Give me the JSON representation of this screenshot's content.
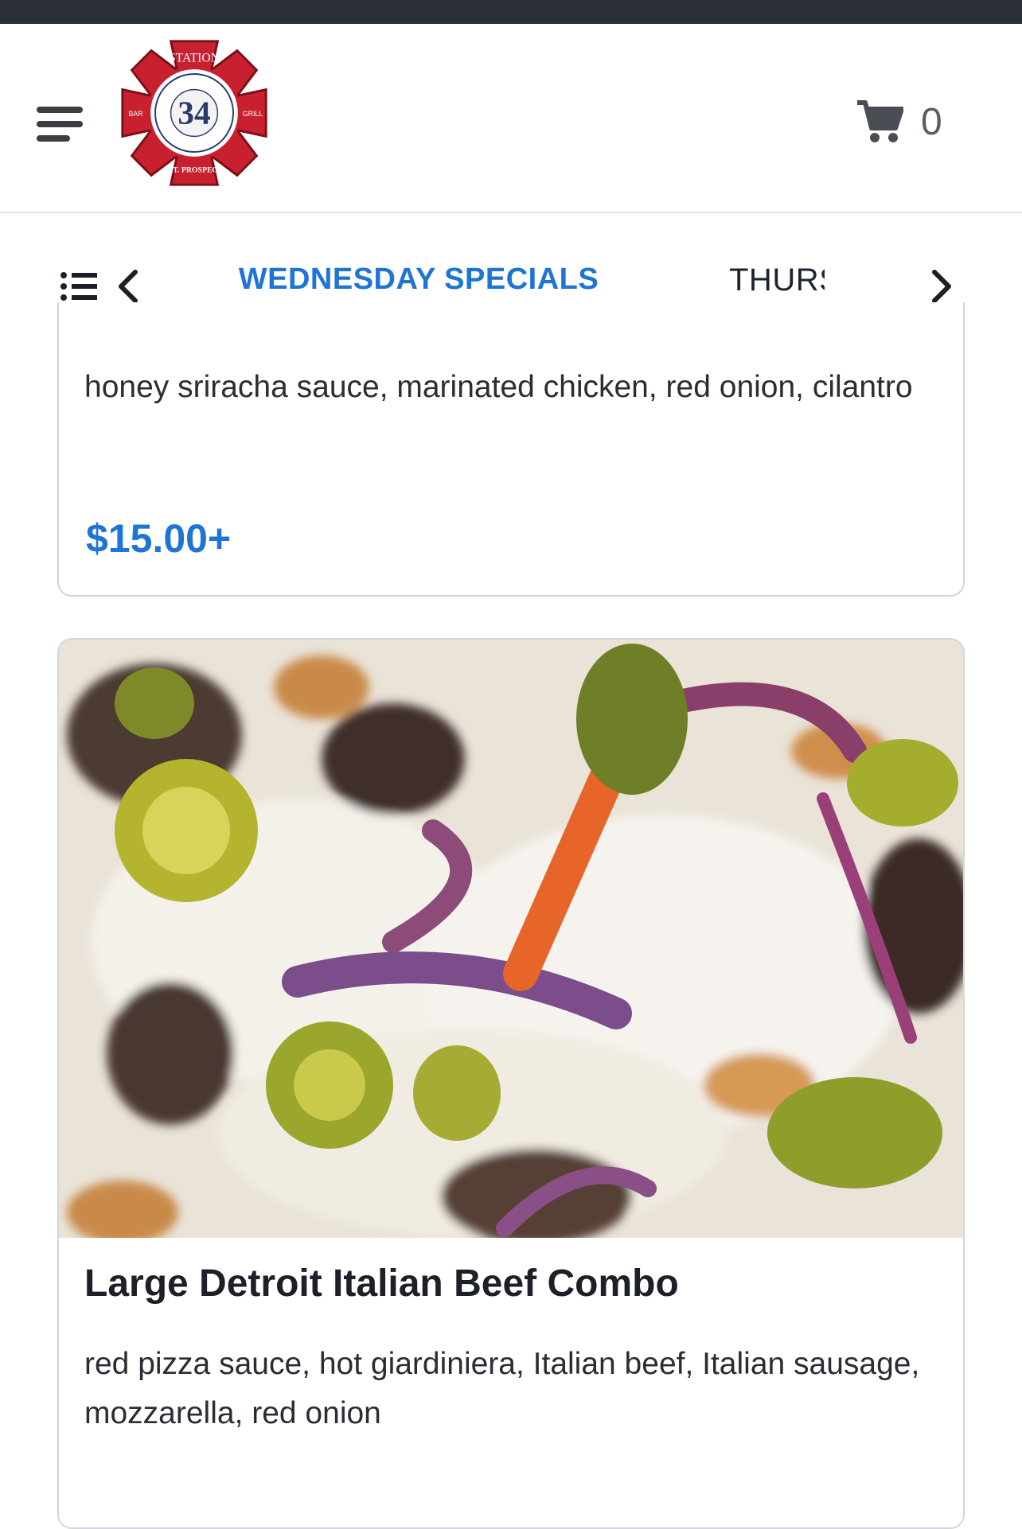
{
  "header": {
    "logo": {
      "top_text": "STATION",
      "number": "34",
      "left_text": "BAR",
      "right_text": "GRILL",
      "bottom_text": "MT. PROSPECT"
    },
    "cart_count": "0"
  },
  "tabs": {
    "items": [
      {
        "label": "WEDNESDAY SPECIALS",
        "active": true
      },
      {
        "label": "THURSDAY"
      }
    ]
  },
  "menu_items": [
    {
      "description": "honey sriracha sauce, marinated chicken, red onion, cilantro",
      "price": "$15.00+"
    },
    {
      "title": "Large Detroit Italian Beef Combo",
      "description": "red pizza sauce, hot giardiniera, Italian beef, Italian sausage, mozzarella, red onion"
    }
  ],
  "colors": {
    "accent": "#1f75d3",
    "logo_red": "#c8202f",
    "header_strip": "#2b2f36"
  },
  "icons": {
    "menu": "hamburger-icon",
    "cart": "cart-icon",
    "category_list": "list-icon",
    "prev": "chevron-left-icon",
    "next": "chevron-right-icon"
  }
}
